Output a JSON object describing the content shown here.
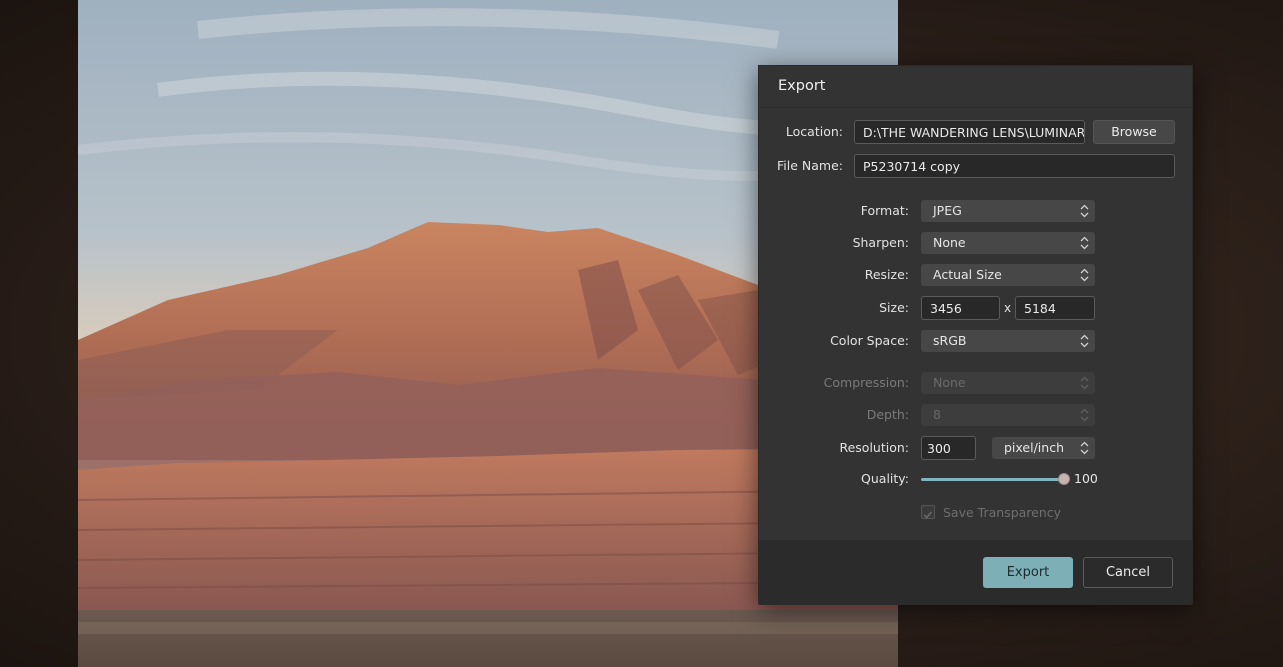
{
  "dialog": {
    "title": "Export",
    "location": {
      "label": "Location:",
      "value": "D:\\THE WANDERING LENS\\LUMINAR",
      "browse_label": "Browse"
    },
    "file_name": {
      "label": "File Name:",
      "value": "P5230714 copy"
    },
    "format": {
      "label": "Format:",
      "value": "JPEG"
    },
    "sharpen": {
      "label": "Sharpen:",
      "value": "None"
    },
    "resize": {
      "label": "Resize:",
      "value": "Actual Size"
    },
    "size": {
      "label": "Size:",
      "width": "3456",
      "separator": "x",
      "height": "5184"
    },
    "color_space": {
      "label": "Color Space:",
      "value": "sRGB"
    },
    "compression": {
      "label": "Compression:",
      "value": "None",
      "disabled": true
    },
    "depth": {
      "label": "Depth:",
      "value": "8",
      "disabled": true
    },
    "resolution": {
      "label": "Resolution:",
      "value": "300",
      "unit": "pixel/inch"
    },
    "quality": {
      "label": "Quality:",
      "value": "100",
      "fraction": 1.0
    },
    "save_transparency": {
      "label": "Save Transparency",
      "checked": true,
      "disabled": true
    },
    "export_label": "Export",
    "cancel_label": "Cancel"
  },
  "colors": {
    "dialog_bg": "#333333",
    "accent": "#7cafb6",
    "slider": "#7fb5bd"
  },
  "icons": {
    "select_arrows": "chevron-updown-icon",
    "checkbox": "checkmark-icon"
  }
}
